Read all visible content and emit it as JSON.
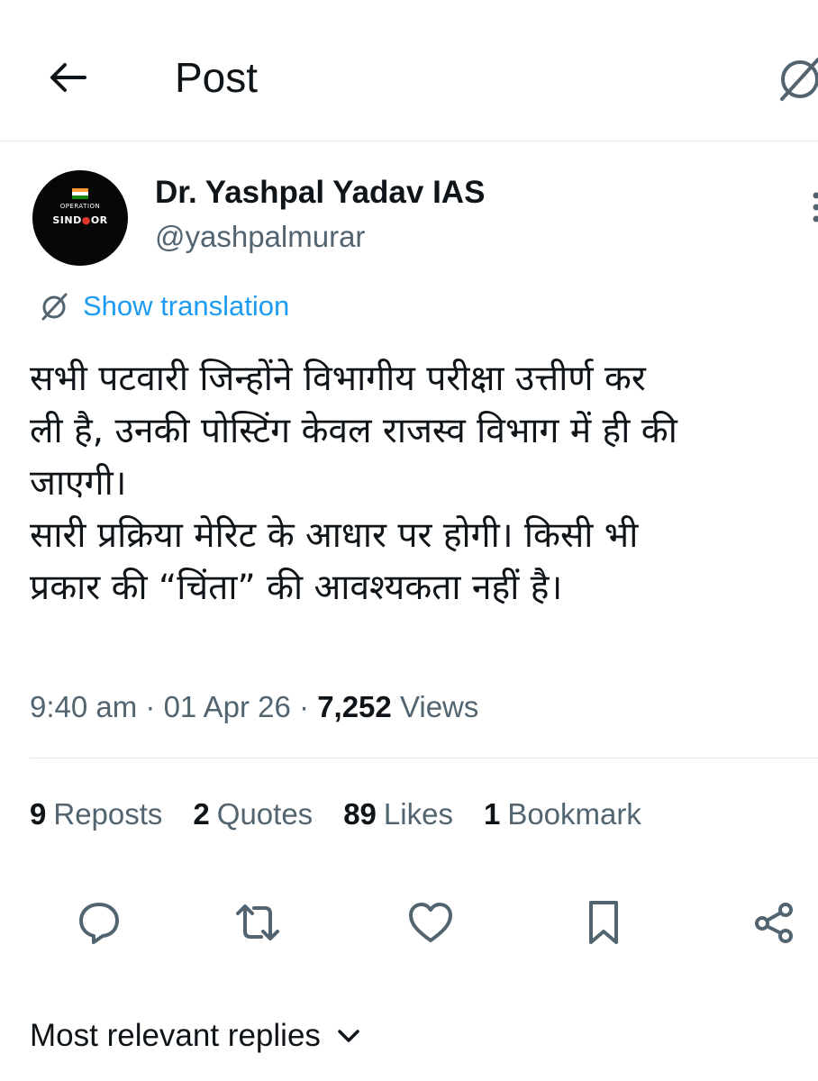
{
  "header": {
    "title": "Post",
    "back_icon": "arrow-left-icon",
    "translate_icon": "translate-globe-icon"
  },
  "author": {
    "display_name": "Dr. Yashpal Yadav IAS",
    "handle": "@yashpalmurar",
    "avatar_text_top": "OPERATION",
    "avatar_text_bottom_left": "SIND",
    "avatar_text_bottom_mid": "●",
    "avatar_text_bottom_right": "OR"
  },
  "translation": {
    "label": "Show translation"
  },
  "post": {
    "lines": [
      "सभी पटवारी जिन्होंने विभागीय परीक्षा उत्तीर्ण कर",
      "ली है, उनकी पोस्टिंग केवल राजस्व विभाग में ही की",
      "जाएगी।",
      "सारी प्रक्रिया मेरिट के आधार पर होगी। किसी भी",
      "प्रकार की “चिंता” की आवश्यकता नहीं है।"
    ],
    "time": "9:40 am",
    "date": "01 Apr 26",
    "separator": " · ",
    "views_count": "7,252",
    "views_label": "Views"
  },
  "stats": [
    {
      "count": "9",
      "label": "Reposts"
    },
    {
      "count": "2",
      "label": "Quotes"
    },
    {
      "count": "89",
      "label": "Likes"
    },
    {
      "count": "1",
      "label": "Bookmark"
    }
  ],
  "actions": [
    "reply-icon",
    "repost-icon",
    "like-icon",
    "bookmark-icon",
    "share-icon"
  ],
  "replies": {
    "sort_label": "Most relevant replies"
  },
  "colors": {
    "text": "#0f1419",
    "secondary": "#536471",
    "accent": "#1d9bf0",
    "divider": "#e6e9ec"
  }
}
